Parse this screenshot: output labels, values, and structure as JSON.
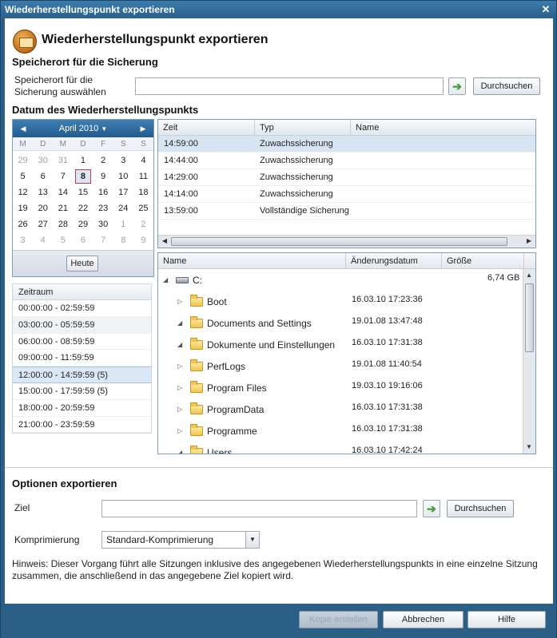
{
  "window": {
    "title": "Wiederherstellungspunkt exportieren",
    "close_glyph": "✕"
  },
  "header": {
    "title": "Wiederherstellungspunkt exportieren"
  },
  "backup_location": {
    "section_title": "Speicherort für die Sicherung",
    "label_line1": "Speicherort für die",
    "label_line2": "Sicherung auswählen",
    "value": "",
    "browse_label": "Durchsuchen"
  },
  "restore_point_date": {
    "section_title": "Datum des Wiederherstellungspunkts"
  },
  "calendar": {
    "month_label": "April 2010",
    "weekdays": [
      "M",
      "D",
      "M",
      "D",
      "F",
      "S",
      "S"
    ],
    "weeks": [
      [
        "29",
        "30",
        "31",
        "1",
        "2",
        "3",
        "4"
      ],
      [
        "5",
        "6",
        "7",
        "8",
        "9",
        "10",
        "11"
      ],
      [
        "12",
        "13",
        "14",
        "15",
        "16",
        "17",
        "18"
      ],
      [
        "19",
        "20",
        "21",
        "22",
        "23",
        "24",
        "25"
      ],
      [
        "26",
        "27",
        "28",
        "29",
        "30",
        "1",
        "2"
      ],
      [
        "3",
        "4",
        "5",
        "6",
        "7",
        "8",
        "9"
      ]
    ],
    "selected_day": "8",
    "today_label": "Heute"
  },
  "time_ranges": {
    "header": "Zeitraum",
    "items": [
      "00:00:00 - 02:59:59",
      "03:00:00 - 05:59:59",
      "06:00:00 - 08:59:59",
      "09:00:00 - 11:59:59",
      "12:00:00 - 14:59:59 (5)",
      "15:00:00 - 17:59:59 (5)",
      "18:00:00 - 20:59:59",
      "21:00:00 - 23:59:59"
    ],
    "selected_index": 4
  },
  "sessions": {
    "columns": [
      "Zeit",
      "Typ",
      "Name"
    ],
    "rows": [
      {
        "time": "14:59:00",
        "type": "Zuwachssicherung",
        "name": ""
      },
      {
        "time": "14:44:00",
        "type": "Zuwachssicherung",
        "name": ""
      },
      {
        "time": "14:29:00",
        "type": "Zuwachssicherung",
        "name": ""
      },
      {
        "time": "14:14:00",
        "type": "Zuwachssicherung",
        "name": ""
      },
      {
        "time": "13:59:00",
        "type": "Vollständige Sicherung",
        "name": ""
      }
    ],
    "selected_index": 0
  },
  "files": {
    "columns": [
      "Name",
      "Änderungsdatum",
      "Größe"
    ],
    "rows": [
      {
        "name": "C:",
        "date": "",
        "size": "6,74 GB",
        "kind": "drive",
        "toggle": "◢"
      },
      {
        "name": "Boot",
        "date": "16.03.10 17:23:36",
        "size": "",
        "kind": "folder",
        "toggle": "▷"
      },
      {
        "name": "Documents and Settings",
        "date": "19.01.08 13:47:48",
        "size": "",
        "kind": "folder",
        "toggle": "◢"
      },
      {
        "name": "Dokumente und Einstellungen",
        "date": "16.03.10 17:31:38",
        "size": "",
        "kind": "folder",
        "toggle": "◢"
      },
      {
        "name": "PerfLogs",
        "date": "19.01.08 11:40:54",
        "size": "",
        "kind": "folder",
        "toggle": "▷"
      },
      {
        "name": "Program Files",
        "date": "19.03.10 19:16:06",
        "size": "",
        "kind": "folder",
        "toggle": "▷"
      },
      {
        "name": "ProgramData",
        "date": "16.03.10 17:31:38",
        "size": "",
        "kind": "folder",
        "toggle": "▷"
      },
      {
        "name": "Programme",
        "date": "16.03.10 17:31:38",
        "size": "",
        "kind": "folder",
        "toggle": "▷"
      },
      {
        "name": "Users",
        "date": "16.03.10 17:42:24",
        "size": "",
        "kind": "folder",
        "toggle": "◢"
      }
    ]
  },
  "export_options": {
    "section_title": "Optionen exportieren",
    "target_label": "Ziel",
    "target_value": "",
    "browse_label": "Durchsuchen",
    "compression_label": "Komprimierung",
    "compression_value": "Standard-Komprimierung",
    "hint": "Hinweis: Dieser Vorgang führt alle Sitzungen inklusive des angegebenen Wiederherstellungspunkts in eine einzelne Sitzung zusammen, die anschließend in das angegebene Ziel kopiert wird."
  },
  "footer": {
    "create_copy_label": "Kopie erstellen",
    "cancel_label": "Abbrechen",
    "help_label": "Hilfe"
  }
}
